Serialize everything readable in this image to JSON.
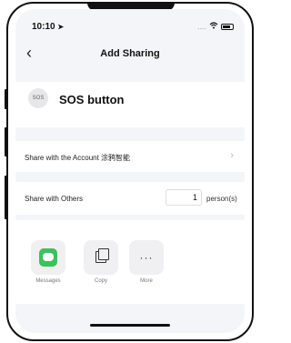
{
  "status": {
    "time": "10:10",
    "time_arrow": "➤",
    "signal": "....",
    "wifi": "wifi"
  },
  "nav": {
    "back_label": "‹",
    "title": "Add Sharing"
  },
  "device": {
    "icon_text": "SOS",
    "name": "SOS button"
  },
  "account": {
    "label": "Share with the Account 涂鸦智能",
    "chevron": "›"
  },
  "others": {
    "label": "Share with Others",
    "count": "1",
    "unit": "person(s)"
  },
  "share": {
    "items": [
      {
        "label": "Messages",
        "icon": "messages-icon"
      },
      {
        "label": "Copy",
        "icon": "copy-icon"
      },
      {
        "label": "More",
        "icon": "more-icon",
        "glyph": "···"
      }
    ]
  }
}
